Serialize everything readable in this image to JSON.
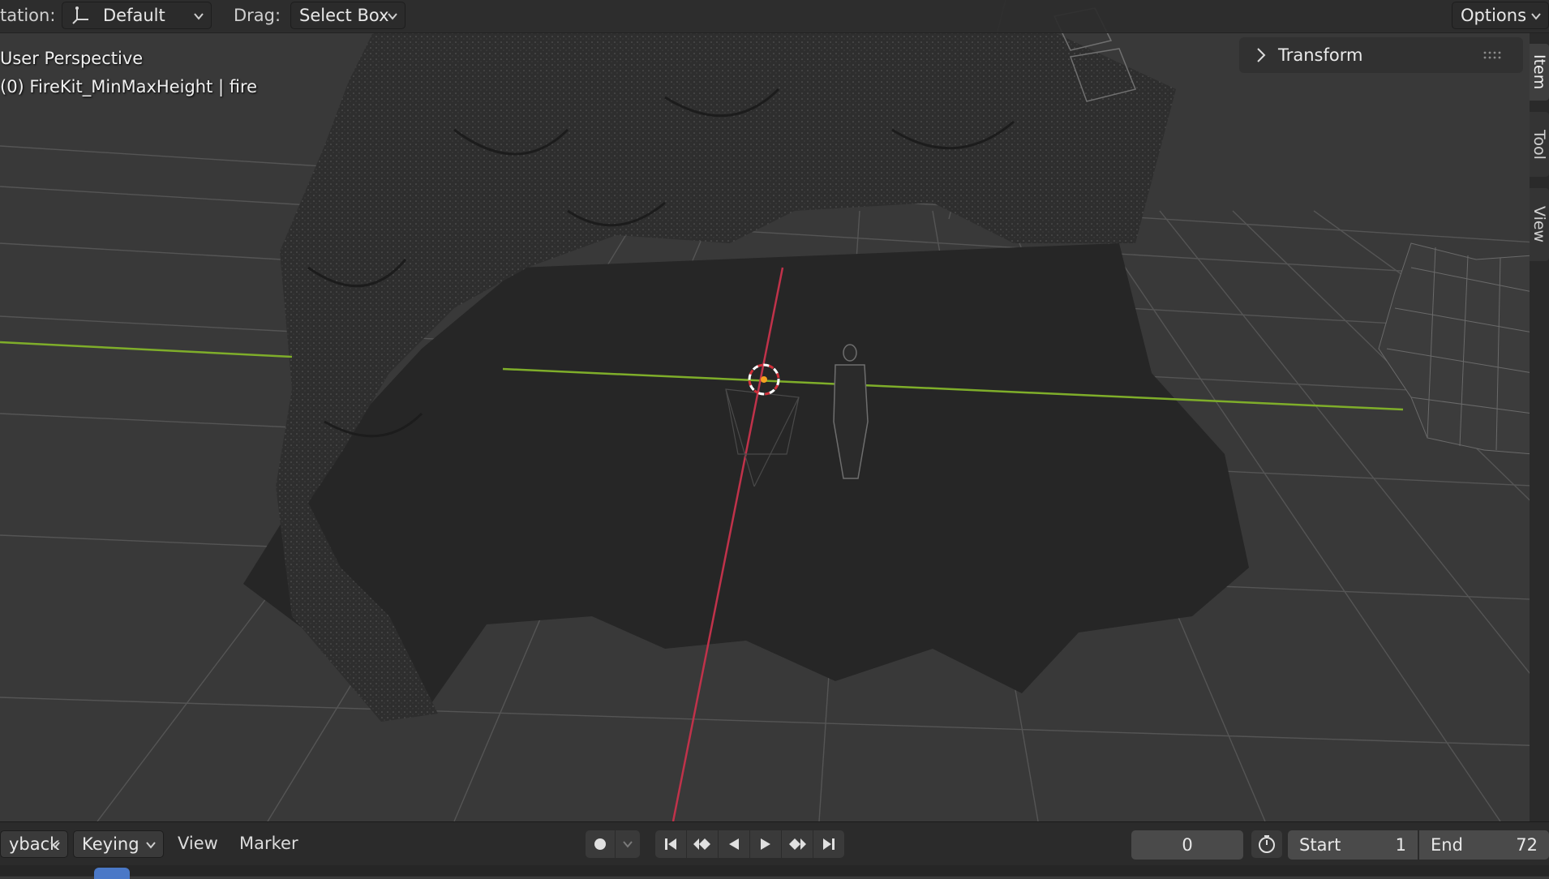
{
  "header": {
    "orientation_label": "tation:",
    "orientation_value": "Default",
    "drag_label": "Drag:",
    "drag_value": "Select Box",
    "options_label": "Options"
  },
  "viewport": {
    "perspective_text": "User Perspective",
    "object_text": "(0) FireKit_MinMaxHeight | fire"
  },
  "sidebar": {
    "panel_title": "Transform",
    "tabs": [
      {
        "label": "Item",
        "active": true
      },
      {
        "label": "Tool",
        "active": false
      },
      {
        "label": "View",
        "active": false
      }
    ]
  },
  "timeline": {
    "menus": [
      "yback",
      "Keying",
      "View",
      "Marker"
    ],
    "current_frame": "0",
    "start_label": "Start",
    "start_value": "1",
    "end_label": "End",
    "end_value": "72"
  },
  "colors": {
    "x_axis": "#c0324a",
    "y_axis": "#7fae2a",
    "active_tab": "#4a78c7"
  },
  "icons": {
    "orientation": "gizmo-orientation-icon",
    "record": "record-icon",
    "jump_start": "jump-start-icon",
    "prev_keyframe": "prev-keyframe-icon",
    "play_reverse": "play-reverse-icon",
    "play": "play-icon",
    "next_keyframe": "next-keyframe-icon",
    "jump_end": "jump-end-icon",
    "timer": "stopwatch-icon"
  }
}
